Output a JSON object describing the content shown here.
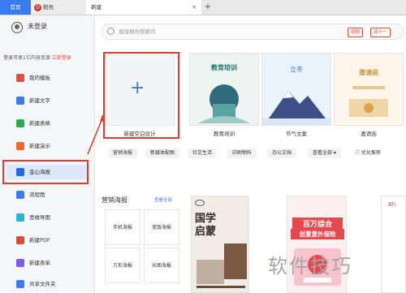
{
  "tabs": {
    "home": "首页",
    "doc": "稻壳",
    "new": "新建",
    "close": "✕",
    "plus": "+"
  },
  "user": {
    "name": "未登录",
    "hint": "登录可享1亿内容资源",
    "login_link": "立即登录"
  },
  "sidebar": {
    "items": [
      {
        "label": "我的模板",
        "color": "#e0503e"
      },
      {
        "label": "新建文字",
        "color": "#3a7cf0"
      },
      {
        "label": "新建表格",
        "color": "#2aa84a"
      },
      {
        "label": "新建演示",
        "color": "#ee6a2c"
      },
      {
        "label": "金山海报",
        "color": "#1f6be5"
      },
      {
        "label": "流程图",
        "color": "#3a7cf0"
      },
      {
        "label": "思维导图",
        "color": "#22b6d9"
      },
      {
        "label": "新建PDF",
        "color": "#e04a3a"
      },
      {
        "label": "新建表单",
        "color": "#7c5ce8"
      },
      {
        "label": "共享文件夹",
        "color": "#3a7cf0"
      }
    ],
    "active_index": 4
  },
  "search": {
    "placeholder": "直接搜你想要的",
    "tag1": "促销",
    "tag2": "双十一"
  },
  "cards": [
    {
      "label": "新建空白设计",
      "title": ""
    },
    {
      "label": "教育培训",
      "title": "教育培训"
    },
    {
      "label": "节气文案",
      "title": "立冬"
    },
    {
      "label": "邀请函",
      "title": "邀请函"
    }
  ],
  "chips": [
    "营销海报",
    "新媒体配图",
    "社交生活",
    "印刷物料",
    "办公文档",
    "查看全部",
    "优化推荐"
  ],
  "section": {
    "title": "营销海报",
    "more": "查看全部",
    "sub_items": [
      "手机海报",
      "宽版海报",
      "方形海报",
      "长图海报"
    ]
  },
  "posters": {
    "p1_title": "国学启蒙",
    "p2_line1": "百万综合",
    "p2_line2": "创意意外保险",
    "p2_badge": "Bh"
  },
  "watermark": "软件技巧"
}
